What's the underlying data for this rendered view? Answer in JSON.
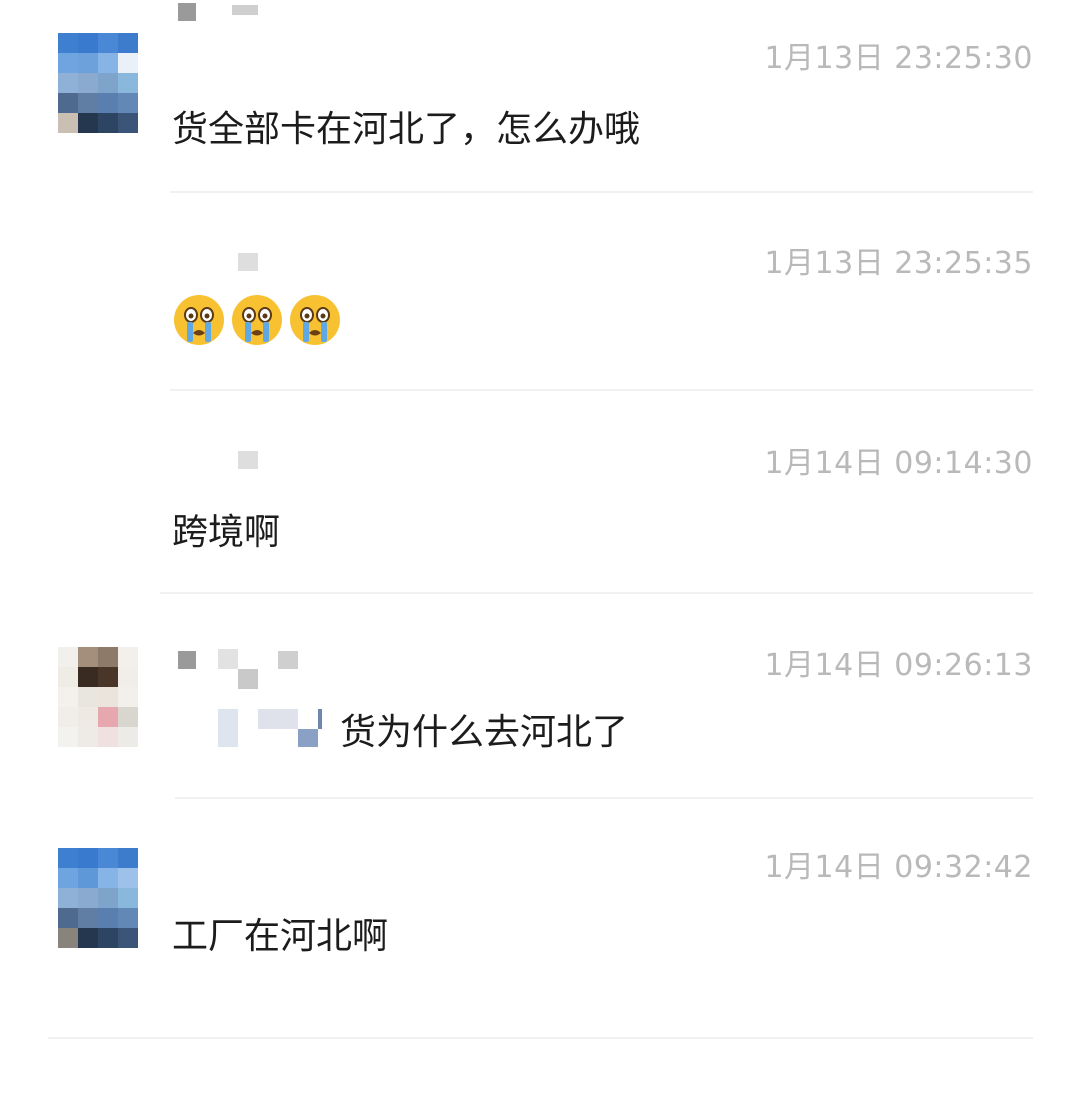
{
  "messages": [
    {
      "time": "1月13日 23:25:30",
      "text": "货全部卡在河北了，怎么办哦"
    },
    {
      "time": "1月13日 23:25:35",
      "emoji": [
        "loudly-crying-face",
        "loudly-crying-face",
        "loudly-crying-face"
      ]
    },
    {
      "time": "1月14日 09:14:30",
      "text": "跨境啊"
    },
    {
      "time": "1月14日 09:26:13",
      "text": "货为什么去河北了"
    },
    {
      "time": "1月14日 09:32:42",
      "text": "工厂在河北啊"
    }
  ],
  "colors": {
    "timestamp": "#b9b9b9",
    "message_text": "#1c1c1c",
    "divider": "#f1f1f1",
    "emoji_face": "#f7c131",
    "emoji_tear": "#5fa8e6"
  },
  "icons": {
    "avatar_style": "pixelated-mosaic",
    "emoji": "loudly-crying-face"
  }
}
